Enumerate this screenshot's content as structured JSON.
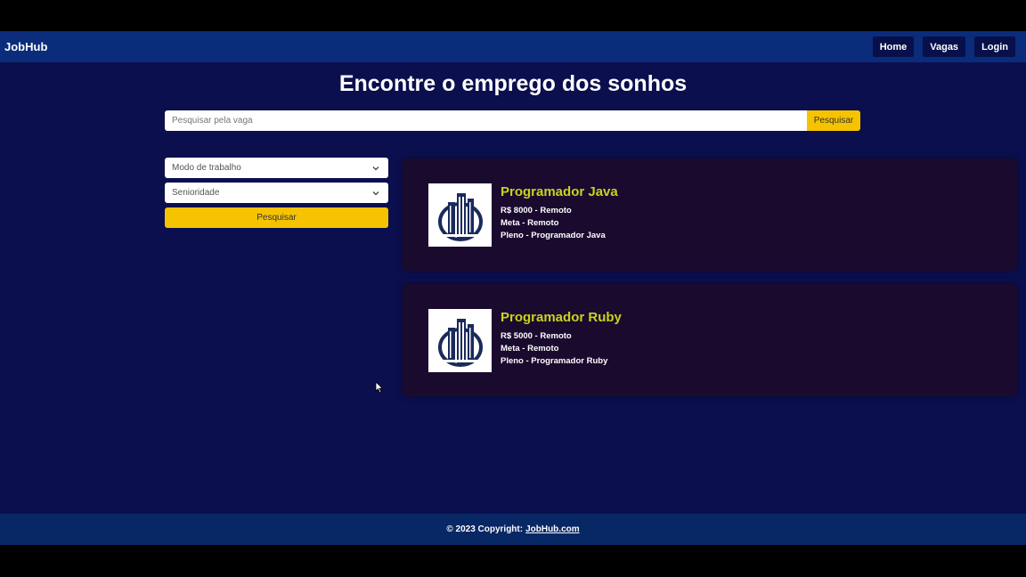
{
  "nav": {
    "brand": "JobHub",
    "links": [
      "Home",
      "Vagas",
      "Login"
    ]
  },
  "hero": {
    "title": "Encontre o emprego dos sonhos",
    "search_placeholder": "Pesquisar pela vaga",
    "search_button": "Pesquisar"
  },
  "filters": {
    "work_mode": "Modo de trabalho",
    "seniority": "Senioridade",
    "button": "Pesquisar"
  },
  "jobs": [
    {
      "title": "Programador Java",
      "line1": "R$ 8000 - Remoto",
      "line2": "Meta - Remoto",
      "line3": "Pleno - Programador Java",
      "logo_icon": "building-logo-icon"
    },
    {
      "title": "Programador Ruby",
      "line1": "R$ 5000 - Remoto",
      "line2": "Meta - Remoto",
      "line3": "Pleno - Programador Ruby",
      "logo_icon": "building-logo-icon"
    }
  ],
  "footer": {
    "copyright": "© 2023 Copyright:",
    "link": "JobHub.com"
  },
  "colors": {
    "navbar": "#0a2c7a",
    "background": "#0b0f4e",
    "accent": "#f5c300",
    "card": "#1a0a2e",
    "job_title": "#c9d21f"
  }
}
